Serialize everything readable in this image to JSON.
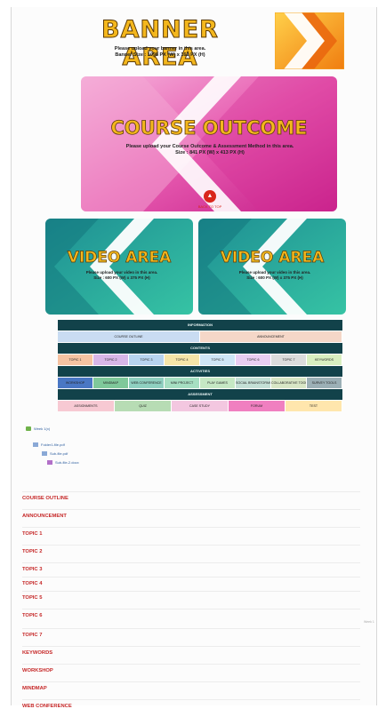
{
  "banner": {
    "title": "BANNER AREA",
    "subtitle_line1": "Please upload your banner in this area.",
    "subtitle_line2": "Banner Size : 1098 PX (W) x 162 PX (H)"
  },
  "outcome": {
    "title": "COURSE OUTCOME",
    "subtitle_line1": "Please upload your Course Outcome & Assessment Method in this area.",
    "subtitle_line2": "Size : 841 PX (W) x 413 PX (H)",
    "badge_label": "BACK TO TOP"
  },
  "videos": [
    {
      "title": "VIDEO AREA",
      "subtitle_line1": "Please upload your video in this area.",
      "subtitle_line2": "Size : 600 PX (W) x 375 PX (H)"
    },
    {
      "title": "VIDEO AREA",
      "subtitle_line1": "Please upload your video in this area.",
      "subtitle_line2": "Size : 600 PX (W) x 375 PX (H)"
    }
  ],
  "nav": {
    "information_header": "INFORMATION",
    "information": [
      "COURSE OUTLINE",
      "ANNOUNCEMENT"
    ],
    "contents_header": "CONTENTS",
    "contents": [
      "TOPIC 1",
      "TOPIC 2",
      "TOPIC 3",
      "TOPIC 4",
      "TOPIC 5",
      "TOPIC 6",
      "TOPIC 7",
      "KEYWORDS"
    ],
    "activities_header": "ACTIVITIES",
    "activities": [
      "WORKSHOP",
      "MINDMAP",
      "WEB CONFERENCE",
      "MINI PROJECT",
      "PLAY GAMES",
      "SOCIAL BRAINSTORMING",
      "COLLABORATIVE TOOLS",
      "SURVEY TOOLS"
    ],
    "assessment_header": "ASSESSMENT",
    "assessment": [
      "ASSIGNMENTS",
      "QUIZ",
      "CASE STUDY",
      "FORUM",
      "TEST"
    ]
  },
  "tree": {
    "root": "Week 1(x)",
    "items": [
      "Folder1-file.pdf",
      "Sub-file.pdf",
      "Sub-file-2.docx"
    ]
  },
  "sections": [
    "COURSE OUTLINE",
    "ANNOUNCEMENT",
    "TOPIC 1",
    "TOPIC 2",
    "TOPIC 3",
    "TOPIC 4",
    "TOPIC 5",
    "TOPIC 6",
    "TOPIC 7",
    "KEYWORDS",
    "WORKSHOP",
    "MINDMAP",
    "WEB CONFERENCE"
  ],
  "side_note": "Week 1",
  "colors": {
    "banner_text": "#f4b71d",
    "section_text": "#c62828",
    "nav_header": "#12424a",
    "info_left": "#c9dcf2",
    "info_right": "#f5d7c8",
    "contents": [
      "#f6c3a2",
      "#d8b6e8",
      "#b8d4f0",
      "#f6e5a8",
      "#cfe6f6",
      "#e9cef2",
      "#dcdcdc",
      "#d9efc0"
    ],
    "activities": [
      "#4a77c4",
      "#7fc89a",
      "#8fd0c0",
      "#a6dfc2",
      "#c6e8c4",
      "#c4e0d6",
      "#d8e6c6",
      "#9cb0b6"
    ],
    "assessment": [
      "#f7c9d3",
      "#b7dcb4",
      "#f3c7e0",
      "#f07fc0",
      "#ffe6ad"
    ]
  }
}
